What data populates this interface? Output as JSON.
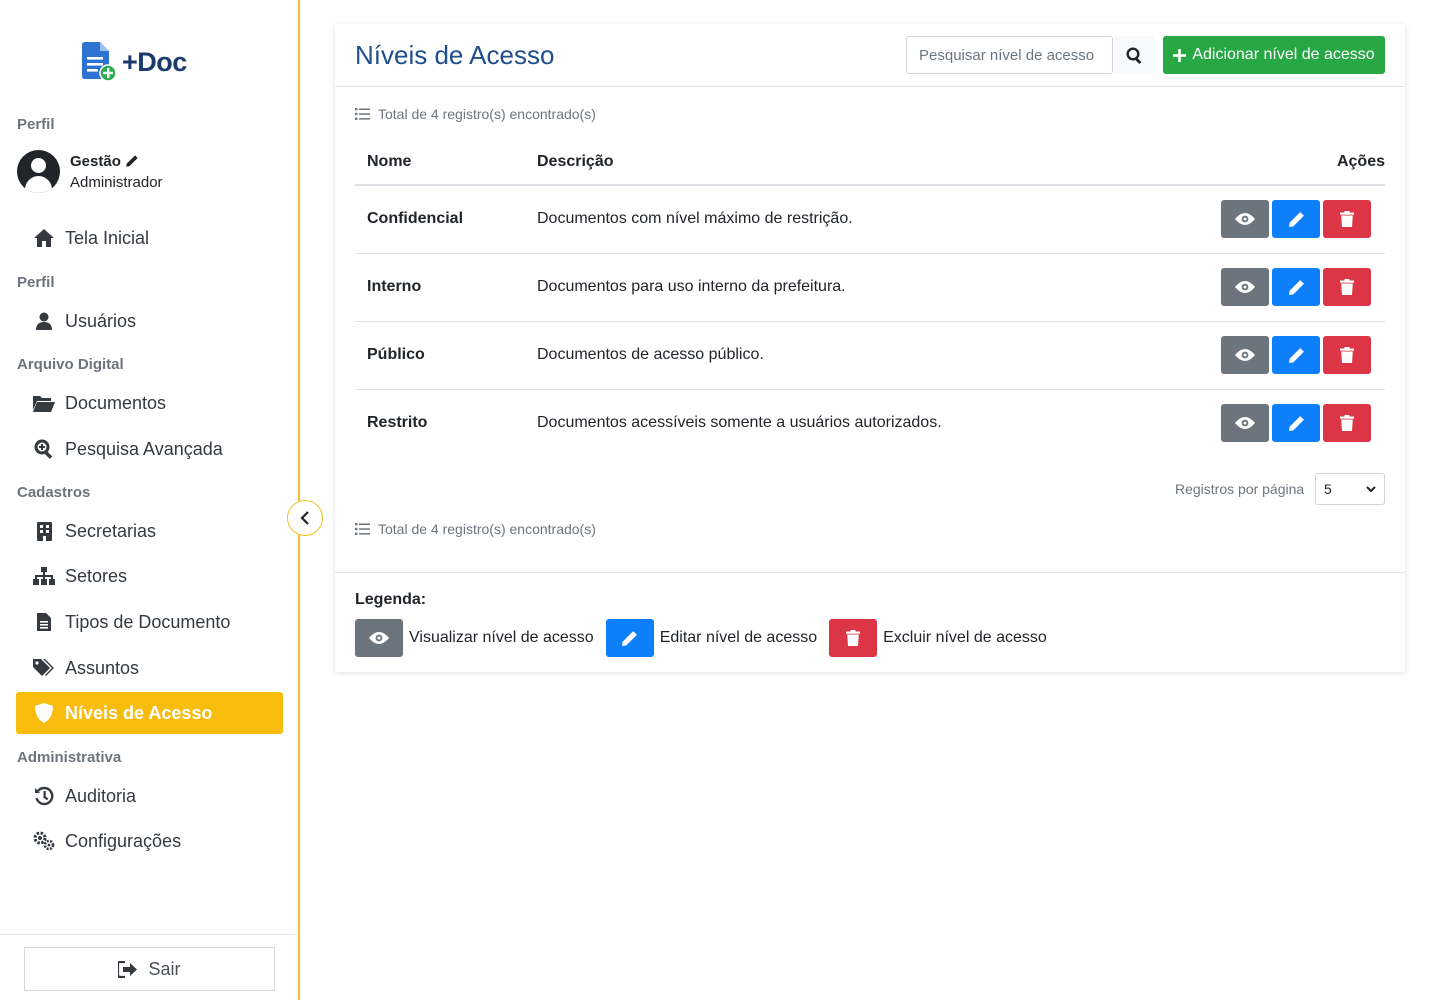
{
  "app": {
    "logo_text": "+Doc"
  },
  "sidebar": {
    "profile_section": "Perfil",
    "user": {
      "name": "Gestão",
      "role": "Administrador"
    },
    "home_item": "Tela Inicial",
    "perfil_section": "Perfil",
    "users_item": "Usuários",
    "arquivo_section": "Arquivo Digital",
    "documents_item": "Documentos",
    "search_item": "Pesquisa Avançada",
    "cadastros_section": "Cadastros",
    "secretarias_item": "Secretarias",
    "setores_item": "Setores",
    "tipos_item": "Tipos de Documento",
    "assuntos_item": "Assuntos",
    "niveis_item": "Níveis de Acesso",
    "admin_section": "Administrativa",
    "auditoria_item": "Auditoria",
    "config_item": "Configurações",
    "logout": "Sair"
  },
  "main": {
    "title": "Níveis de Acesso",
    "search_placeholder": "Pesquisar nível de acesso",
    "add_button": "Adicionar nível de acesso",
    "total_text": "Total de 4 registro(s) encontrado(s)",
    "columns": {
      "name": "Nome",
      "description": "Descrição",
      "actions": "Ações"
    },
    "rows": [
      {
        "name": "Confidencial",
        "description": "Documentos com nível máximo de restrição."
      },
      {
        "name": "Interno",
        "description": "Documentos para uso interno da prefeitura."
      },
      {
        "name": "Público",
        "description": "Documentos de acesso público."
      },
      {
        "name": "Restrito",
        "description": "Documentos acessíveis somente a usuários autorizados."
      }
    ],
    "per_page_label": "Registros por página",
    "per_page_value": "5",
    "legend": {
      "title": "Legenda:",
      "view": "Visualizar nível de acesso",
      "edit": "Editar nível de acesso",
      "delete": "Excluir nível de acesso"
    }
  },
  "colors": {
    "accent": "#f8bd0c",
    "success": "#28a745",
    "primary": "#0d7ff8",
    "danger": "#dc3545",
    "secondary": "#6c757d",
    "title": "#1f4e8c"
  }
}
